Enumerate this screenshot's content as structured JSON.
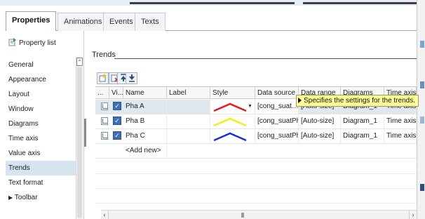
{
  "main_tabs": [
    {
      "label": "Properties",
      "active": true
    },
    {
      "label": "Animations",
      "active": false
    },
    {
      "label": "Events",
      "active": false
    },
    {
      "label": "Texts",
      "active": false
    }
  ],
  "left_nav": {
    "property_list_label": "Property list",
    "items": [
      {
        "label": "General",
        "selected": false
      },
      {
        "label": "Appearance",
        "selected": false
      },
      {
        "label": "Layout",
        "selected": false
      },
      {
        "label": "Window",
        "selected": false
      },
      {
        "label": "Diagrams",
        "selected": false
      },
      {
        "label": "Time axis",
        "selected": false
      },
      {
        "label": "Value axis",
        "selected": false
      },
      {
        "label": "Trends",
        "selected": true
      },
      {
        "label": "Text format",
        "selected": false
      },
      {
        "label": "Toolbar",
        "selected": false,
        "expandable": true
      }
    ]
  },
  "content": {
    "section_title": "Trends"
  },
  "table": {
    "columns": [
      "...",
      "Vi...",
      "Name",
      "Label",
      "Style",
      "Data source",
      "Data range",
      "Diagrams",
      "Time axis"
    ],
    "rows": [
      {
        "visible": true,
        "name": "Pha A",
        "label": "",
        "style_color": "#e8141e",
        "data_source": "[cong_suat…",
        "data_range": "[Auto-size]",
        "diagram": "Diagram_1",
        "time_axis": "Time axis",
        "selected": true
      },
      {
        "visible": true,
        "name": "Pha B",
        "label": "",
        "style_color": "#f5ee12",
        "data_source": "[cong_suatPha...",
        "data_range": "[Auto-size]",
        "diagram": "Diagram_1",
        "time_axis": "Time axis",
        "selected": false
      },
      {
        "visible": true,
        "name": "Pha C",
        "label": "",
        "style_color": "#1a2ee0",
        "data_source": "[cong_suatPha...",
        "data_range": "[Auto-size]",
        "diagram": "Diagram_1",
        "time_axis": "Time axis",
        "selected": false
      }
    ],
    "add_new_label": "<Add new>"
  },
  "tooltip": {
    "text": "Specifies the settings for the trends."
  }
}
